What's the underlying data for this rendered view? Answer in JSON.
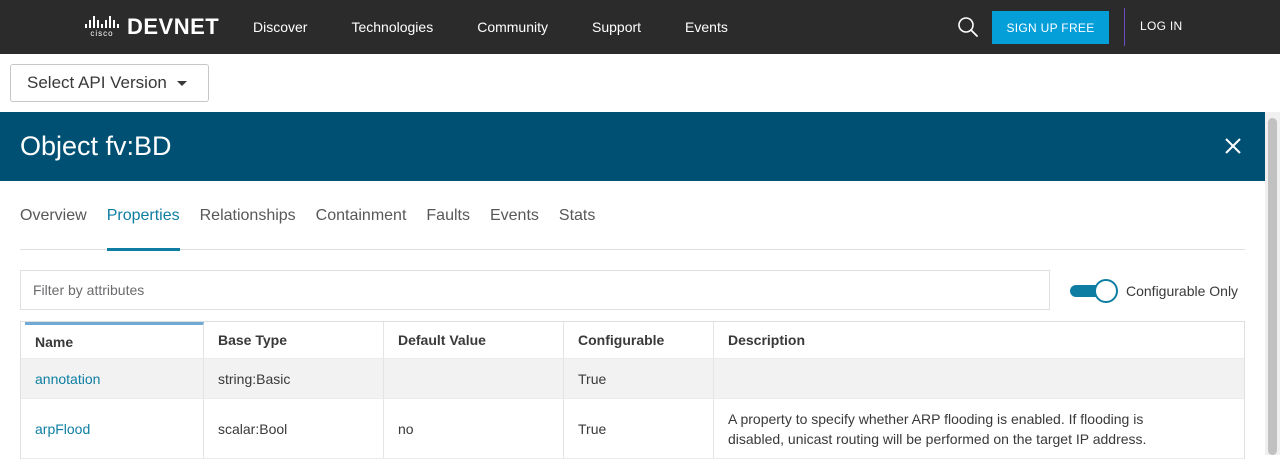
{
  "topnav": {
    "brand_small": "cisco",
    "brand": "DEVNET",
    "links": [
      "Discover",
      "Technologies",
      "Community",
      "Support",
      "Events"
    ],
    "signup_label": "SIGN UP FREE",
    "login_label": "LOG IN",
    "search_icon": "search-icon"
  },
  "api_select": {
    "label": "Select API Version"
  },
  "panel": {
    "title": "Object fv:BD",
    "close_icon": "close-icon"
  },
  "tabs": [
    {
      "label": "Overview",
      "active": false
    },
    {
      "label": "Properties",
      "active": true
    },
    {
      "label": "Relationships",
      "active": false
    },
    {
      "label": "Containment",
      "active": false
    },
    {
      "label": "Faults",
      "active": false
    },
    {
      "label": "Events",
      "active": false
    },
    {
      "label": "Stats",
      "active": false
    }
  ],
  "filter": {
    "placeholder": "Filter by attributes",
    "value": ""
  },
  "toggle": {
    "label": "Configurable Only",
    "on": true
  },
  "table": {
    "columns": [
      "Name",
      "Base Type",
      "Default Value",
      "Configurable",
      "Description"
    ],
    "rows": [
      {
        "name": "annotation",
        "base_type": "string:Basic",
        "default": "",
        "configurable": "True",
        "description": ""
      },
      {
        "name": "arpFlood",
        "base_type": "scalar:Bool",
        "default": "no",
        "configurable": "True",
        "description": "A property to specify whether ARP flooding is enabled. If flooding is disabled, unicast routing will be performed on the target IP address."
      }
    ]
  },
  "colors": {
    "nav_bg": "#2b2b2b",
    "accent": "#049fd9",
    "panel_header": "#005073",
    "link": "#0d7ea2"
  }
}
